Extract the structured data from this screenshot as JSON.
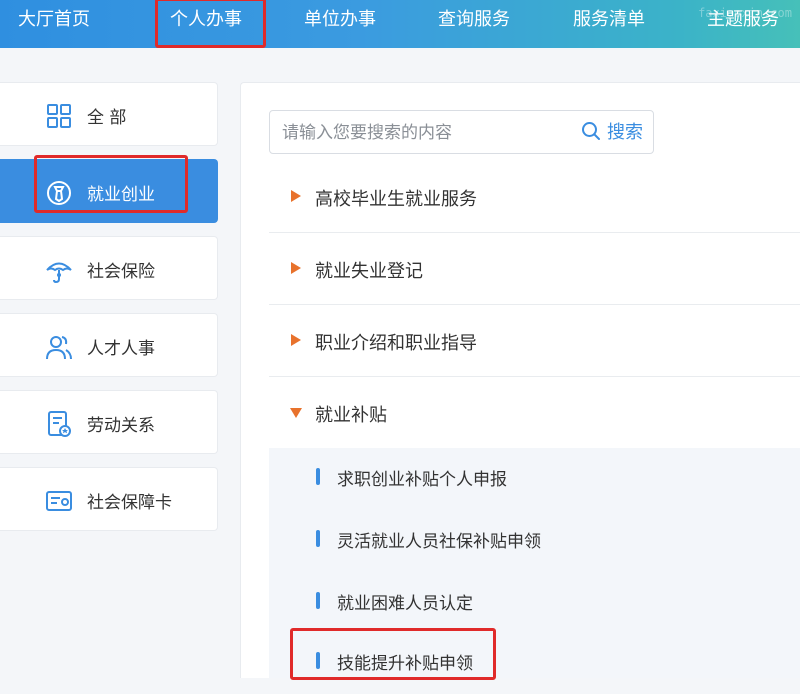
{
  "nav": {
    "items": [
      "大厅首页",
      "个人办事",
      "单位办事",
      "查询服务",
      "服务清单",
      "主题服务"
    ],
    "active_index": 1,
    "watermark": "faxiaoxin.com"
  },
  "sidebar": {
    "items": [
      {
        "label": "全 部",
        "icon": "grid-icon"
      },
      {
        "label": "就业创业",
        "icon": "employment-icon",
        "active": true
      },
      {
        "label": "社会保险",
        "icon": "umbrella-icon"
      },
      {
        "label": "人才人事",
        "icon": "people-icon"
      },
      {
        "label": "劳动关系",
        "icon": "document-badge-icon"
      },
      {
        "label": "社会保障卡",
        "icon": "card-icon"
      }
    ]
  },
  "search": {
    "placeholder": "请输入您要搜索的内容",
    "button_label": "搜索"
  },
  "categories": [
    {
      "label": "高校毕业生就业服务",
      "expanded": false
    },
    {
      "label": "就业失业登记",
      "expanded": false
    },
    {
      "label": "职业介绍和职业指导",
      "expanded": false
    },
    {
      "label": "就业补贴",
      "expanded": true
    }
  ],
  "subitems": [
    {
      "label": "求职创业补贴个人申报"
    },
    {
      "label": "灵活就业人员社保补贴申领"
    },
    {
      "label": "就业困难人员认定"
    },
    {
      "label": "技能提升补贴申领",
      "highlighted": true
    }
  ],
  "colors": {
    "accent": "#3a8de0",
    "highlight_box": "#e02a2a",
    "triangle": "#e8722c"
  }
}
